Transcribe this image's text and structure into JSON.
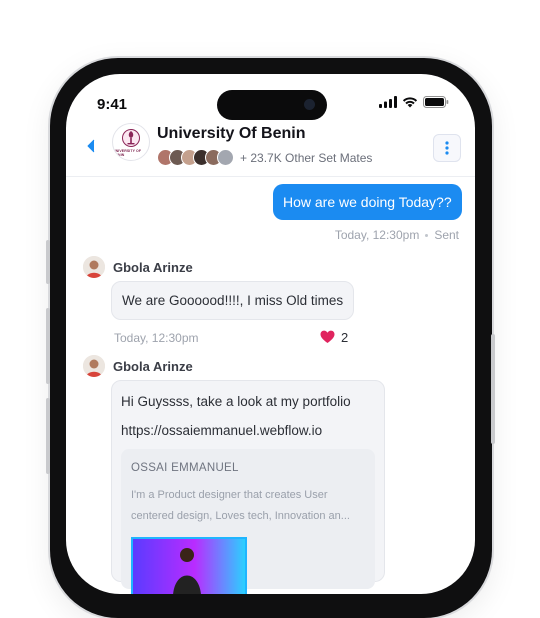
{
  "status_bar": {
    "time": "9:41"
  },
  "header": {
    "avatar_text": "UNIVERSITY OF BENIN",
    "title": "University Of Benin",
    "mates_text": "+ 23.7K Other Set Mates"
  },
  "messages": [
    {
      "direction": "out",
      "text": "How are we doing Today??",
      "timestamp": "Today, 12:30pm",
      "status": "Sent"
    },
    {
      "direction": "in",
      "sender": "Gbola Arinze",
      "text": "We are Goooood!!!!, I miss Old times",
      "timestamp": "Today, 12:30pm",
      "reaction": {
        "emoji": "❤️",
        "count": "2"
      }
    },
    {
      "direction": "in",
      "sender": "Gbola Arinze",
      "line1": "Hi Guyssss, take a look at my portfolio",
      "line2": "https://ossaiemmanuel.webflow.io",
      "preview": {
        "title": "OSSAI EMMANUEL",
        "desc_line1": "I'm a Product designer that creates User",
        "desc_line2": "centered design, Loves tech, Innovation an..."
      }
    }
  ],
  "colors": {
    "accent": "#1b8bf1",
    "bubble_in": "#f3f4f7",
    "heart": "#e0245e"
  }
}
